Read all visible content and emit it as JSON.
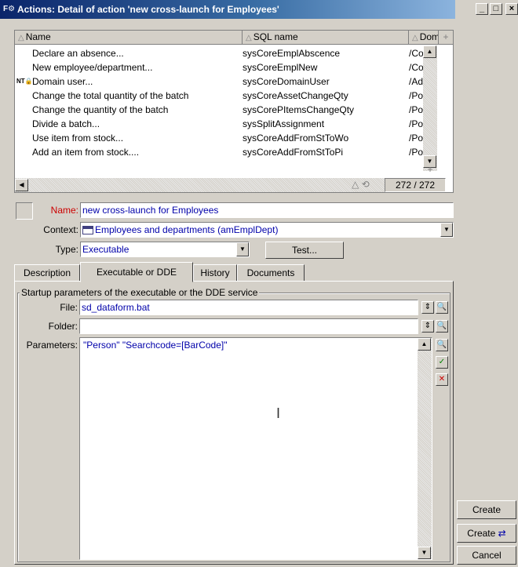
{
  "window": {
    "title": "Actions: Detail of action 'new cross-launch for Employees'",
    "app_icon": "actions-icon",
    "minimize_label": "_",
    "maximize_label": "□",
    "close_label": "×"
  },
  "list": {
    "columns": [
      "Name",
      "SQL name",
      "Dom"
    ],
    "rows": [
      {
        "name": "Declare an absence...",
        "sql": "sysCoreEmplAbscence",
        "dom": "/Core/"
      },
      {
        "name": "New employee/department...",
        "sql": "sysCoreEmplNew",
        "dom": "/Core/"
      },
      {
        "name": "Domain user...",
        "sql": "sysCoreDomainUser",
        "dom": "/Admir",
        "icon": "nt-user-icon"
      },
      {
        "name": "Change the total quantity of the batch",
        "sql": "sysCoreAssetChangeQty",
        "dom": "/Portfc"
      },
      {
        "name": "Change the quantity of the batch",
        "sql": "sysCorePItemsChangeQty",
        "dom": "/Portfc"
      },
      {
        "name": "Divide a batch...",
        "sql": "sysSplitAssignment",
        "dom": "/Portfc"
      },
      {
        "name": "Use item from stock...",
        "sql": "sysCoreAddFromStToWo",
        "dom": "/Portfc"
      },
      {
        "name": "Add an item from stock....",
        "sql": "sysCoreAddFromStToPi",
        "dom": "/Portfc"
      }
    ],
    "count": "272 / 272"
  },
  "form": {
    "name_label": "Name:",
    "name_value": "new cross-launch for Employees",
    "context_label": "Context:",
    "context_value": "Employees and departments (amEmplDept)",
    "type_label": "Type:",
    "type_value": "Executable",
    "test_button": "Test..."
  },
  "tabs": [
    {
      "label": "Description",
      "active": false
    },
    {
      "label": "Executable or DDE",
      "active": true
    },
    {
      "label": "History",
      "active": false
    },
    {
      "label": "Documents",
      "active": false
    }
  ],
  "panel": {
    "group_title": "Startup parameters of the executable or the DDE service",
    "file_label": "File:",
    "file_value": "sd_dataform.bat",
    "folder_label": "Folder:",
    "folder_value": "",
    "parameters_label": "Parameters:",
    "parameters_value": "\"Person\" \"Searchcode=[BarCode]\""
  },
  "side": {
    "create_button": "Create",
    "create_link_button": "Create",
    "cancel_button": "Cancel"
  },
  "colors": {
    "titlebar_start": "#0a246a",
    "titlebar_end": "#a6caf0",
    "field_text": "#0000aa",
    "name_label": "#cc0000",
    "validate_green": "#008000",
    "cancel_red": "#cc0000"
  }
}
